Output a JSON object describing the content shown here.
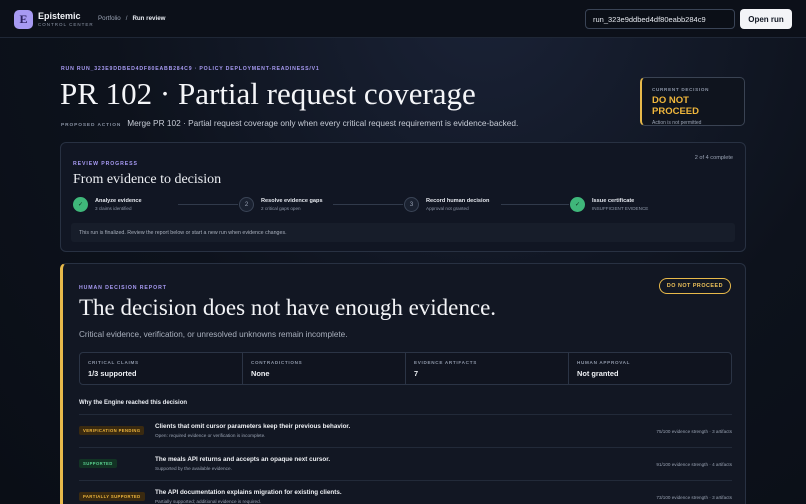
{
  "brand": {
    "logo_letter": "E",
    "name": "Epistemic",
    "subtitle": "CONTROL CENTER"
  },
  "breadcrumb": {
    "items": [
      "Portfolio",
      "Run review"
    ],
    "separator": "/"
  },
  "run_search": {
    "value": "run_323e9ddbed4df80eabb284c9"
  },
  "open_run_label": "Open run",
  "header": {
    "eyebrow": "RUN RUN_323E9DDBED4DF80EABB284C9 · POLICY DEPLOYMENT-READINESS/V1",
    "title": "PR 102 · Partial request coverage",
    "proposed_label": "PROPOSED ACTION",
    "proposed_text": "Merge PR 102 · Partial request coverage only when every critical request requirement is evidence-backed."
  },
  "current_decision": {
    "label": "CURRENT DECISION",
    "value": "DO NOT PROCEED",
    "sub": "Action is not permitted",
    "accent": "#e7b94a"
  },
  "review_progress": {
    "eyebrow": "REVIEW PROGRESS",
    "count": "2 of 4 complete",
    "title": "From evidence to decision",
    "steps": [
      {
        "num": "✓",
        "title": "Analyze evidence",
        "sub": "3 claims identified",
        "done": true
      },
      {
        "num": "2",
        "title": "Resolve evidence gaps",
        "sub": "2 critical gaps open",
        "done": false
      },
      {
        "num": "3",
        "title": "Record human decision",
        "sub": "Approval not granted",
        "done": false
      },
      {
        "num": "✓",
        "title": "Issue certificate",
        "sub": "INSUFFICIENT EVIDENCE",
        "done": true
      }
    ],
    "note": "This run is finalized. Review the report below or start a new run when evidence changes."
  },
  "report": {
    "eyebrow": "HUMAN DECISION REPORT",
    "badge": "DO NOT PROCEED",
    "title": "The decision does not have enough evidence.",
    "subtitle": "Critical evidence, verification, or unresolved unknowns remain incomplete.",
    "stats": [
      {
        "label": "CRITICAL CLAIMS",
        "value": "1/3 supported"
      },
      {
        "label": "CONTRADICTIONS",
        "value": "None"
      },
      {
        "label": "EVIDENCE ARTIFACTS",
        "value": "7"
      },
      {
        "label": "HUMAN APPROVAL",
        "value": "Not granted"
      }
    ],
    "why_heading": "Why the Engine reached this decision",
    "claims": [
      {
        "tag": "VERIFICATION PENDING",
        "tag_kind": "pending",
        "title": "Clients that omit cursor parameters keep their previous behavior.",
        "sub": "Open: required evidence or verification is incomplete.",
        "meta": "75/100 evidence strength · 3 artifacts"
      },
      {
        "tag": "SUPPORTED",
        "tag_kind": "supported",
        "title": "The meals API returns and accepts an opaque next cursor.",
        "sub": "Supported by the available evidence.",
        "meta": "91/100 evidence strength · 4 artifacts"
      },
      {
        "tag": "PARTIALLY SUPPORTED",
        "tag_kind": "partial",
        "title": "The API documentation explains migration for existing clients.",
        "sub": "Partially supported; additional evidence is required.",
        "meta": "73/100 evidence strength · 3 artifacts"
      }
    ]
  }
}
